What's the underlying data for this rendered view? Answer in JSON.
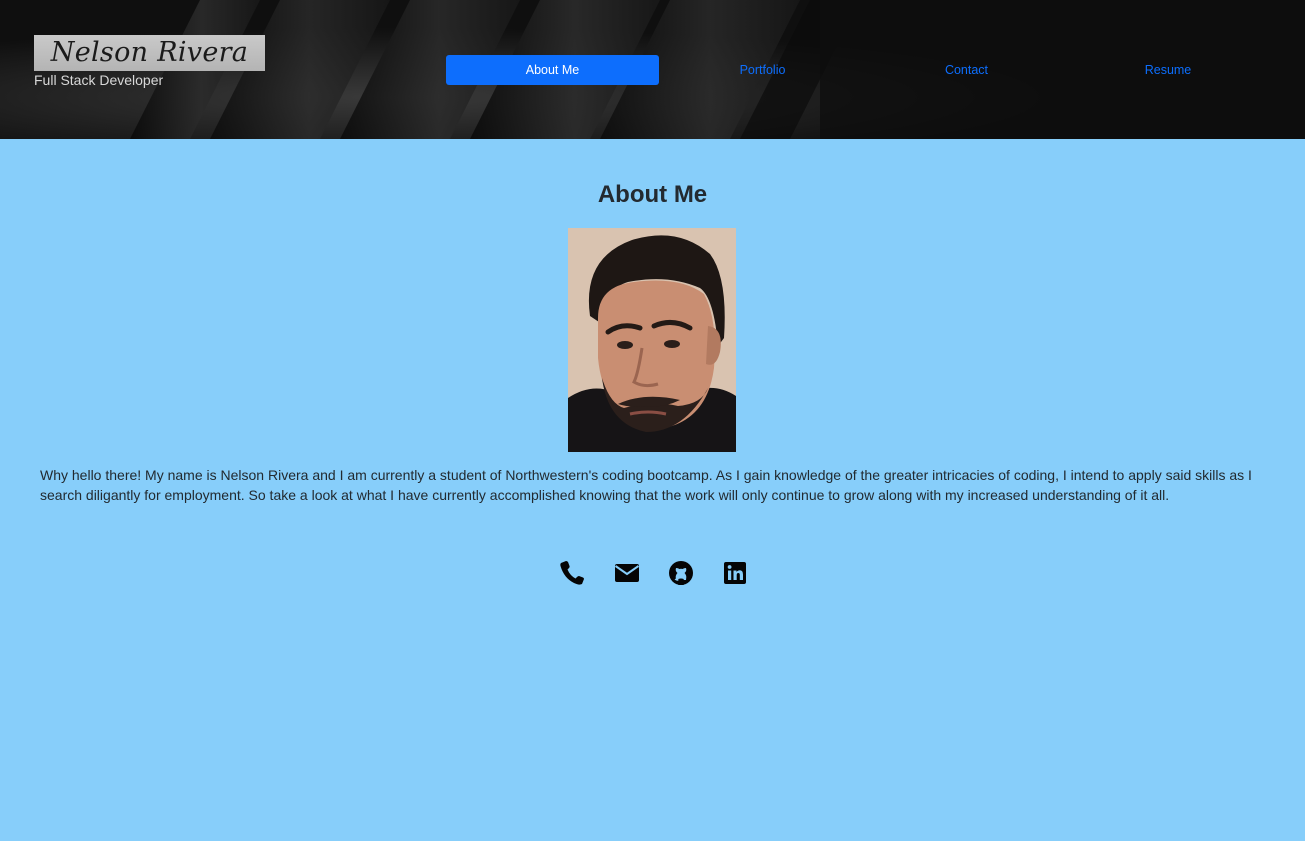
{
  "header": {
    "name": "Nelson Rivera",
    "subtitle": "Full Stack Developer"
  },
  "nav": {
    "items": [
      {
        "label": "About Me",
        "active": true
      },
      {
        "label": "Portfolio",
        "active": false
      },
      {
        "label": "Contact",
        "active": false
      },
      {
        "label": "Resume",
        "active": false
      }
    ]
  },
  "main": {
    "title": "About Me",
    "photo_alt": "profile-photo",
    "bio": "Why hello there! My name is Nelson Rivera and I am currently a student of Northwestern's coding bootcamp. As I gain knowledge of the greater intricacies of coding, I intend to apply said skills as I search diligantly for employment. So take a look at what I have currently accomplished knowing that the work will only continue to grow along with my increased understanding of it all."
  },
  "social": {
    "icons": [
      "phone-icon",
      "envelope-icon",
      "github-icon",
      "linkedin-icon"
    ]
  },
  "colors": {
    "page_background": "#87cefa",
    "header_background": "#121212",
    "accent": "#0d6efd"
  }
}
